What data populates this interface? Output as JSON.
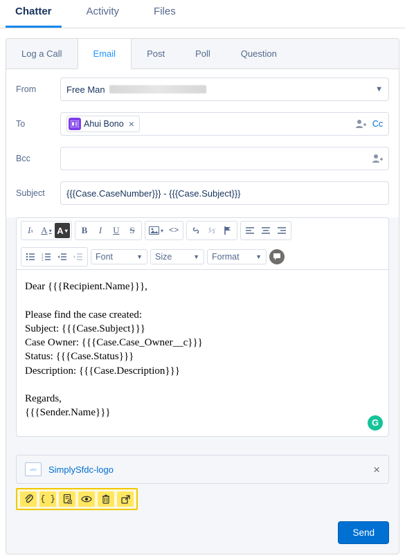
{
  "topTabs": [
    "Chatter",
    "Activity",
    "Files"
  ],
  "subTabs": [
    "Log a Call",
    "Email",
    "Post",
    "Poll",
    "Question"
  ],
  "labels": {
    "from": "From",
    "to": "To",
    "bcc": "Bcc",
    "subject": "Subject",
    "cc": "Cc"
  },
  "from": {
    "name": "Free Man"
  },
  "to": {
    "recipient": {
      "name": "Ahui Bono"
    }
  },
  "subject": "{{{Case.CaseNumber}}} - {{{Case.Subject}}}",
  "toolbar": {
    "font": "Font",
    "size": "Size",
    "format": "Format"
  },
  "body": {
    "l1": "Dear {{{Recipient.Name}}},",
    "l2": "Please find the case created:",
    "l3": "Subject: {{{Case.Subject}}}",
    "l4": "Case Owner: {{{Case.Case_Owner__c}}}",
    "l5": "Status: {{{Case.Status}}}",
    "l6": "Description: {{{Case.Description}}}",
    "l7": "Regards,",
    "l8": "{{{Sender.Name}}}"
  },
  "attachment": {
    "name": "SimplySfdc-logo"
  },
  "send": "Send",
  "grammarly": "G"
}
